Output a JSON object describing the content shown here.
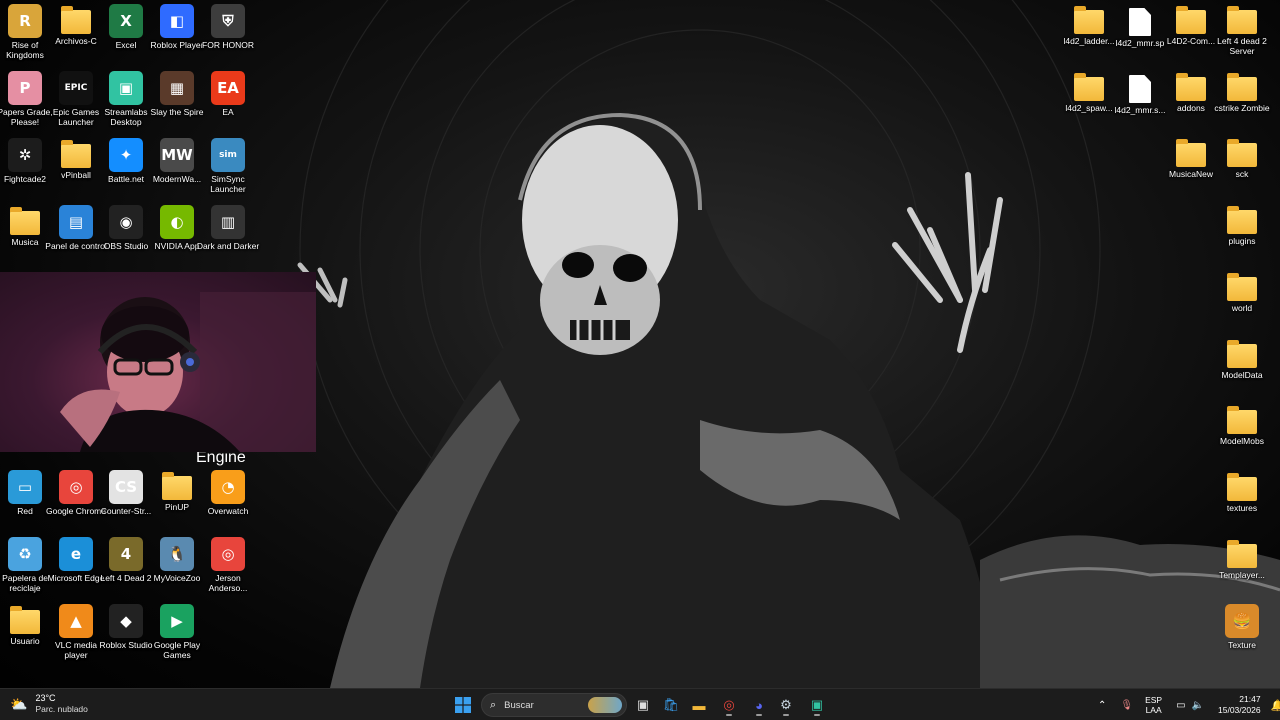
{
  "desktop": {
    "icons_left": [
      {
        "label": "Rise of Kingdoms",
        "icon": "game-icon",
        "color": "#d9a53a",
        "glyph": "R"
      },
      {
        "label": "Archivos-C",
        "icon": "folder-icon"
      },
      {
        "label": "Excel",
        "icon": "excel-icon",
        "color": "#1f7a45",
        "glyph": "X"
      },
      {
        "label": "Roblox Player",
        "icon": "roblox-icon",
        "color": "#2f6bff",
        "glyph": "◧"
      },
      {
        "label": "FOR HONOR",
        "icon": "for-honor-icon",
        "color": "#3d3d3d",
        "glyph": "⛨"
      },
      {
        "label": "Papers Grade, Please!",
        "icon": "game-icon",
        "color": "#e58fa3",
        "glyph": "P"
      },
      {
        "label": "Epic Games Launcher",
        "icon": "epic-games-icon",
        "color": "#111111",
        "glyph": "EPIC"
      },
      {
        "label": "Streamlabs Desktop",
        "icon": "streamlabs-icon",
        "color": "#31c3a2",
        "glyph": "▣"
      },
      {
        "label": "Slay the Spire",
        "icon": "slay-the-spire-icon",
        "color": "#5a3a2a",
        "glyph": "▦"
      },
      {
        "label": "EA",
        "icon": "ea-icon",
        "color": "#ea3a1a",
        "glyph": "EA"
      },
      {
        "label": "Fightcade2",
        "icon": "fightcade-icon",
        "color": "#1c1c1c",
        "glyph": "✲"
      },
      {
        "label": "vPinball",
        "icon": "folder-icon"
      },
      {
        "label": "Battle.net",
        "icon": "battle-net-icon",
        "color": "#148eff",
        "glyph": "✦"
      },
      {
        "label": "ModernWa...",
        "icon": "modern-warfare-icon",
        "color": "#4a4a4a",
        "glyph": "MW"
      },
      {
        "label": "SimSync Launcher",
        "icon": "simsync-icon",
        "color": "#3a8ac0",
        "glyph": "sim"
      },
      {
        "label": "Musica",
        "icon": "folder-icon"
      },
      {
        "label": "Panel de control",
        "icon": "control-panel-icon",
        "color": "#2a83d8",
        "glyph": "▤"
      },
      {
        "label": "OBS Studio",
        "icon": "obs-icon",
        "color": "#222222",
        "glyph": "◉"
      },
      {
        "label": "NVIDIA App",
        "icon": "nvidia-icon",
        "color": "#76b900",
        "glyph": "◐"
      },
      {
        "label": "Dark and Darker",
        "icon": "dark-and-darker-icon",
        "color": "#333333",
        "glyph": "▥"
      }
    ],
    "icons_left_bottom": [
      {
        "label": "Red",
        "icon": "network-icon",
        "color": "#2a9ad8",
        "glyph": "▭"
      },
      {
        "label": "Google Chrome",
        "icon": "chrome-icon",
        "color": "#e8453c",
        "glyph": "◎"
      },
      {
        "label": "Counter-Str...",
        "icon": "counter-strike-icon",
        "color": "#e3e3e3",
        "glyph": "CS"
      },
      {
        "label": "PinUP",
        "icon": "folder-icon"
      },
      {
        "label": "Overwatch",
        "icon": "overwatch-icon",
        "color": "#f99e1a",
        "glyph": "◔"
      },
      {
        "label": "Papelera de reciclaje",
        "icon": "recycle-bin-icon",
        "color": "#4aa3df",
        "glyph": "♻"
      },
      {
        "label": "Microsoft Edge",
        "icon": "edge-icon",
        "color": "#1b8fd8",
        "glyph": "e"
      },
      {
        "label": "Left 4 Dead 2",
        "icon": "left4dead-icon",
        "color": "#7a6a2a",
        "glyph": "4"
      },
      {
        "label": "MyVoiceZoo",
        "icon": "myvoicezoo-icon",
        "color": "#5a8ab0",
        "glyph": "🐧"
      },
      {
        "label": "Jerson Anderso...",
        "icon": "chrome-icon",
        "color": "#e8453c",
        "glyph": "◎"
      },
      {
        "label": "Usuario",
        "icon": "folder-icon"
      },
      {
        "label": "VLC media player",
        "icon": "vlc-icon",
        "color": "#f08a1a",
        "glyph": "▲"
      },
      {
        "label": "Roblox Studio",
        "icon": "roblox-studio-icon",
        "color": "#222222",
        "glyph": "◆"
      },
      {
        "label": "Google Play Games",
        "icon": "google-play-games-icon",
        "color": "#1aa260",
        "glyph": "▶"
      }
    ],
    "engine_label": "Engine",
    "icons_right": [
      {
        "label": "l4d2_ladder...",
        "icon": "folder-icon"
      },
      {
        "label": "l4d2_mmr.sp",
        "icon": "file-icon"
      },
      {
        "label": "L4D2-Com...",
        "icon": "folder-icon"
      },
      {
        "label": "Left 4 dead 2 Server",
        "icon": "folder-icon"
      },
      {
        "label": "l4d2_spaw...",
        "icon": "folder-icon"
      },
      {
        "label": "l4d2_mmr.s...",
        "icon": "file-icon"
      },
      {
        "label": "addons",
        "icon": "folder-icon"
      },
      {
        "label": "cstrike Zombie",
        "icon": "folder-icon"
      },
      {
        "label": "MusicaNew",
        "icon": "folder-icon"
      },
      {
        "label": "sck",
        "icon": "folder-icon"
      },
      {
        "label": "plugins",
        "icon": "folder-icon"
      },
      {
        "label": "world",
        "icon": "folder-icon"
      },
      {
        "label": "ModelData",
        "icon": "folder-icon"
      },
      {
        "label": "ModelMobs",
        "icon": "folder-icon"
      },
      {
        "label": "textures",
        "icon": "folder-icon"
      },
      {
        "label": "Templayer...",
        "icon": "folder-icon"
      },
      {
        "label": "Texture",
        "icon": "burger-icon",
        "color": "#d98a2a",
        "glyph": "🍔"
      }
    ]
  },
  "taskbar": {
    "weather_temp": "23°C",
    "weather_condition": "Parc. nublado",
    "search_placeholder": "Buscar",
    "apps": [
      {
        "name": "start-button",
        "icon": "windows-logo-icon",
        "color": "#3aa0f0",
        "glyph": "⊞"
      },
      {
        "name": "task-view-button",
        "icon": "task-view-icon",
        "color": "#dddddd",
        "glyph": "▣"
      },
      {
        "name": "store-button",
        "icon": "store-icon",
        "color": "#3aa0f0",
        "glyph": "🛍"
      },
      {
        "name": "file-explorer-button",
        "icon": "folder-icon",
        "color": "#f2b83a",
        "glyph": "▬"
      },
      {
        "name": "chrome-button",
        "icon": "chrome-icon",
        "color": "#e8453c",
        "glyph": "◎"
      },
      {
        "name": "discord-button",
        "icon": "discord-icon",
        "color": "#5865f2",
        "glyph": "◕"
      },
      {
        "name": "steam-button",
        "icon": "steam-icon",
        "color": "#c7d5e0",
        "glyph": "⚙"
      },
      {
        "name": "streamlabs-button",
        "icon": "streamlabs-icon",
        "color": "#31c3a2",
        "glyph": "▣"
      }
    ],
    "language_top": "ESP",
    "language_bottom": "LAA",
    "time": "21:47",
    "date": "15/03/2026"
  }
}
